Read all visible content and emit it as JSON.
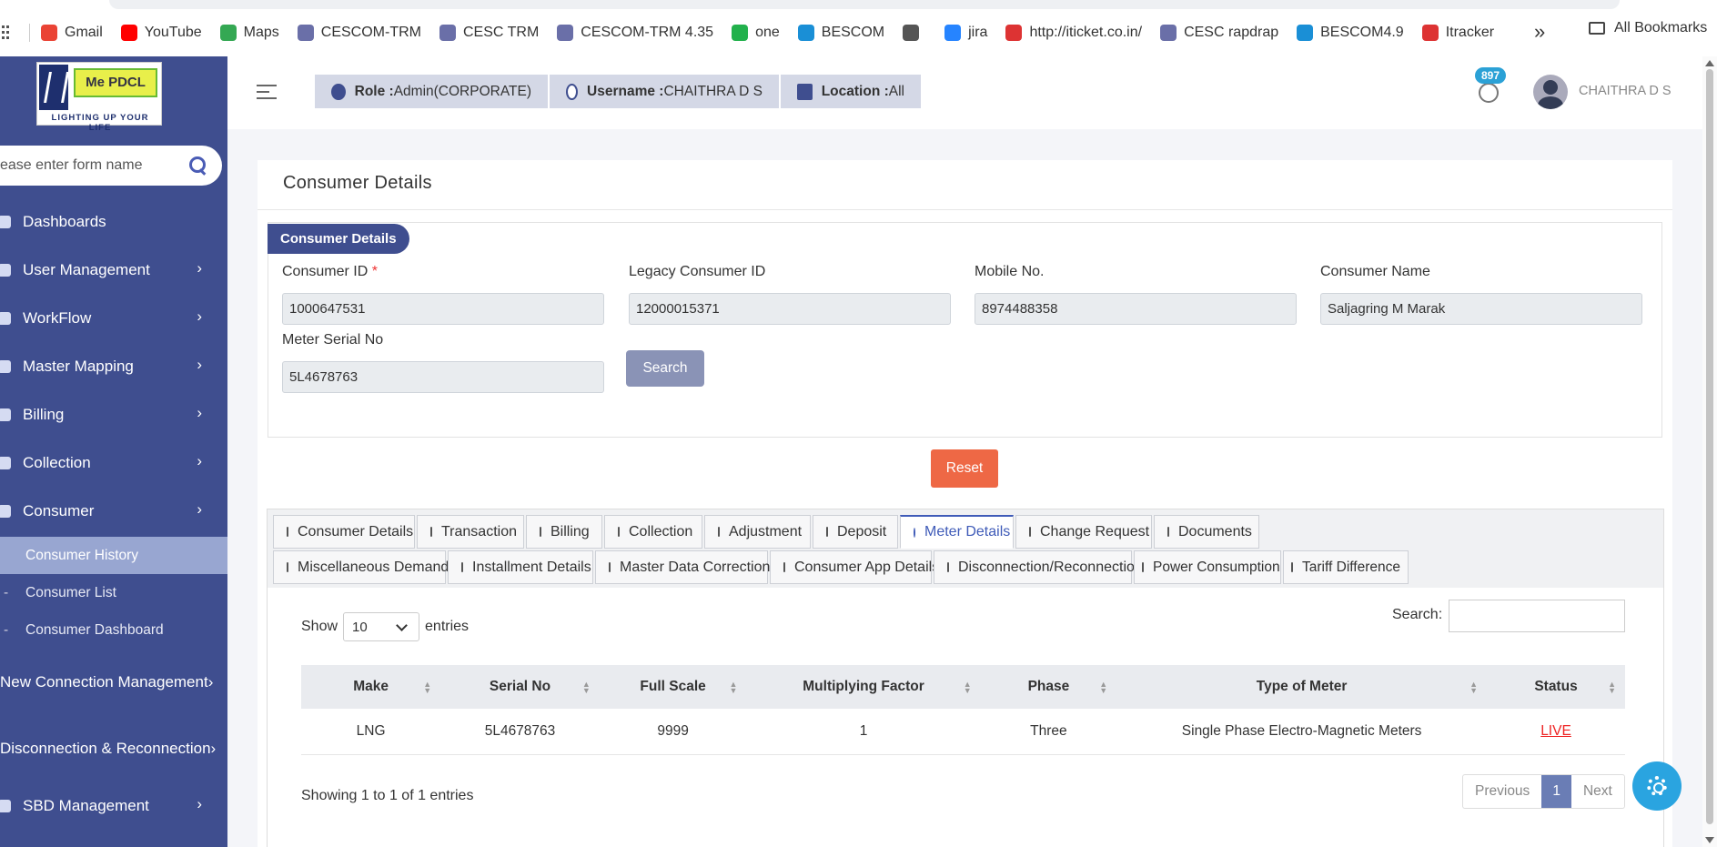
{
  "bookmarks": {
    "items": [
      {
        "label": "Gmail",
        "icon": "gmail-icon",
        "color": "#ea4335"
      },
      {
        "label": "YouTube",
        "icon": "youtube-icon",
        "color": "#ff0000"
      },
      {
        "label": "Maps",
        "icon": "maps-icon",
        "color": "#34a853"
      },
      {
        "label": "CESCOM-TRM",
        "icon": "cescom-icon",
        "color": "#6a6fa8"
      },
      {
        "label": "CESC TRM",
        "icon": "cescom-icon",
        "color": "#6a6fa8"
      },
      {
        "label": "CESCOM-TRM 4.35",
        "icon": "cescom-icon",
        "color": "#6a6fa8"
      },
      {
        "label": "one",
        "icon": "one-icon",
        "color": "#22b14c"
      },
      {
        "label": "BESCOM",
        "icon": "bescom-icon",
        "color": "#1a8fd6"
      },
      {
        "label": "",
        "icon": "globe-icon",
        "color": "#555555"
      },
      {
        "label": "jira",
        "icon": "jira-icon",
        "color": "#2684ff"
      },
      {
        "label": "http://iticket.co.in/",
        "icon": "iticket-icon",
        "color": "#d33"
      },
      {
        "label": "CESC rapdrap",
        "icon": "cescom-icon",
        "color": "#6a6fa8"
      },
      {
        "label": "BESCOM4.9",
        "icon": "bescom-icon",
        "color": "#1a8fd6"
      },
      {
        "label": "Itracker",
        "icon": "itracker-icon",
        "color": "#d33"
      }
    ],
    "all": "All Bookmarks",
    "more": "»"
  },
  "logo": {
    "name": "Me PDCL",
    "tagline": "LIGHTING UP YOUR LIFE"
  },
  "sidebar": {
    "search_placeholder": "ease enter form name",
    "items": [
      {
        "label": "Dashboards",
        "icon": "dashboard-icon",
        "arrow": ""
      },
      {
        "label": "User Management",
        "icon": "user-icon",
        "arrow": "›"
      },
      {
        "label": "WorkFlow",
        "icon": "anchor-icon",
        "arrow": "›"
      },
      {
        "label": "Master Mapping",
        "icon": "sitemap-icon",
        "arrow": "›"
      },
      {
        "label": "Billing",
        "icon": "monitor-icon",
        "arrow": "›"
      },
      {
        "label": "Collection",
        "icon": "list-icon",
        "arrow": "›"
      },
      {
        "label": "Consumer",
        "icon": "user-icon",
        "arrow": "›"
      }
    ],
    "sub": [
      "Consumer History",
      "Consumer List",
      "Consumer Dashboard"
    ],
    "items2": [
      {
        "label": "New Connection Management",
        "icon": "plus-circle-icon",
        "arrow": "›"
      },
      {
        "label": "Disconnection & Reconnection",
        "icon": "link-icon",
        "arrow": "›"
      }
    ],
    "items3": [
      {
        "label": "SBD Management",
        "icon": "monitor-icon",
        "arrow": "›"
      }
    ]
  },
  "header": {
    "role_label": "Role :",
    "role": "Admin(CORPORATE)",
    "user_label": "Username :",
    "user": "CHAITHRA D S",
    "loc_label": "Location :",
    "loc": "All",
    "badge": "897",
    "name": "CHAITHRA D S"
  },
  "page": {
    "title": "Consumer Details",
    "section": "Consumer Details",
    "fields": {
      "cid_label": "Consumer ID",
      "cid": "1000647531",
      "legacy_label": "Legacy Consumer ID",
      "legacy": "12000015371",
      "mobile_label": "Mobile No.",
      "mobile": "8974488358",
      "name_label": "Consumer Name",
      "name": "Saljagring M  Marak",
      "meter_label": "Meter Serial No",
      "meter": "5L4678763"
    },
    "search_btn": "Search",
    "reset_btn": "Reset",
    "tabs1": [
      "Consumer Details",
      "Transaction",
      "Billing",
      "Collection",
      "Adjustment",
      "Deposit",
      "Meter Details",
      "Change Request",
      "Documents"
    ],
    "tabs2": [
      "Miscellaneous Demand",
      "Installment Details",
      "Master Data Correction",
      "Consumer App Details",
      "Disconnection/Reconnection",
      "Power Consumption",
      "Tariff Difference"
    ],
    "show": "Show",
    "entries": "entries",
    "page_size": "10",
    "search_label": "Search:",
    "columns": [
      "Make",
      "Serial No",
      "Full Scale",
      "Multiplying Factor",
      "Phase",
      "Type of Meter",
      "Status"
    ],
    "rows": [
      [
        "LNG",
        "5L4678763",
        "9999",
        "1",
        "Three",
        "Single Phase Electro-Magnetic Meters",
        "LIVE"
      ]
    ],
    "info": "Showing 1 to 1 of 1 entries",
    "prev": "Previous",
    "page_no": "1",
    "next": "Next"
  }
}
